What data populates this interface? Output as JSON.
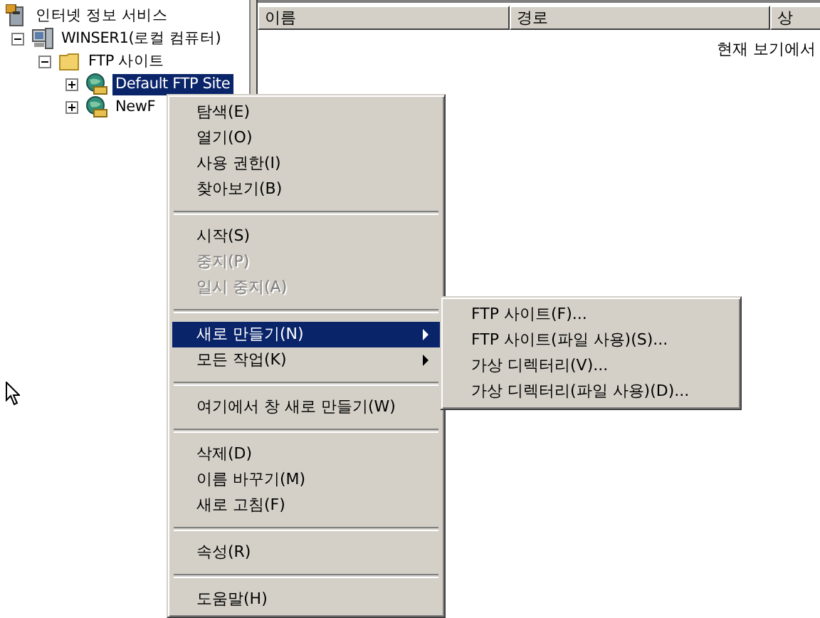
{
  "tree": [
    {
      "label": "인터넷 정보 서비스",
      "kind": "services",
      "selected": false,
      "children": [
        {
          "label": "WINSER1(로컬 컴퓨터)",
          "kind": "computer",
          "expanded": true,
          "selected": false,
          "children": [
            {
              "label": "FTP 사이트",
              "kind": "folder",
              "expanded": true,
              "selected": false,
              "children": [
                {
                  "label": "Default FTP Site",
                  "kind": "site",
                  "expanded": false,
                  "selected": true
                },
                {
                  "label": "NewF",
                  "kind": "site",
                  "expanded": false,
                  "selected": false
                }
              ]
            }
          ]
        }
      ]
    }
  ],
  "table": {
    "columns": [
      "이름",
      "경로",
      "상"
    ],
    "message": "현재 보기에서"
  },
  "context_menu": [
    {
      "kind": "item",
      "label": "탐색(E)",
      "disabled": false,
      "selected": false,
      "submenu": false
    },
    {
      "kind": "item",
      "label": "열기(O)",
      "disabled": false,
      "selected": false,
      "submenu": false
    },
    {
      "kind": "item",
      "label": "사용 권한(I)",
      "disabled": false,
      "selected": false,
      "submenu": false
    },
    {
      "kind": "item",
      "label": "찾아보기(B)",
      "disabled": false,
      "selected": false,
      "submenu": false
    },
    {
      "kind": "separator"
    },
    {
      "kind": "item",
      "label": "시작(S)",
      "disabled": false,
      "selected": false,
      "submenu": false
    },
    {
      "kind": "item",
      "label": "중지(P)",
      "disabled": true,
      "selected": false,
      "submenu": false
    },
    {
      "kind": "item",
      "label": "일시 중지(A)",
      "disabled": true,
      "selected": false,
      "submenu": false
    },
    {
      "kind": "separator"
    },
    {
      "kind": "item",
      "label": "새로 만들기(N)",
      "disabled": false,
      "selected": true,
      "submenu": true
    },
    {
      "kind": "item",
      "label": "모든 작업(K)",
      "disabled": false,
      "selected": false,
      "submenu": true
    },
    {
      "kind": "separator"
    },
    {
      "kind": "item",
      "label": "여기에서 창 새로 만들기(W)",
      "disabled": false,
      "selected": false,
      "submenu": false
    },
    {
      "kind": "separator"
    },
    {
      "kind": "item",
      "label": "삭제(D)",
      "disabled": false,
      "selected": false,
      "submenu": false
    },
    {
      "kind": "item",
      "label": "이름 바꾸기(M)",
      "disabled": false,
      "selected": false,
      "submenu": false
    },
    {
      "kind": "item",
      "label": "새로 고침(F)",
      "disabled": false,
      "selected": false,
      "submenu": false
    },
    {
      "kind": "separator"
    },
    {
      "kind": "item",
      "label": "속성(R)",
      "disabled": false,
      "selected": false,
      "submenu": false
    },
    {
      "kind": "separator"
    },
    {
      "kind": "item",
      "label": "도움말(H)",
      "disabled": false,
      "selected": false,
      "submenu": false
    }
  ],
  "submenu": [
    {
      "label": "FTP 사이트(F)...",
      "selected": false
    },
    {
      "label": "FTP 사이트(파일 사용)(S)...",
      "selected": false
    },
    {
      "label": "가상 디렉터리(V)...",
      "selected": false
    },
    {
      "label": "가상 디렉터리(파일 사용)(D)...",
      "selected": false
    }
  ]
}
